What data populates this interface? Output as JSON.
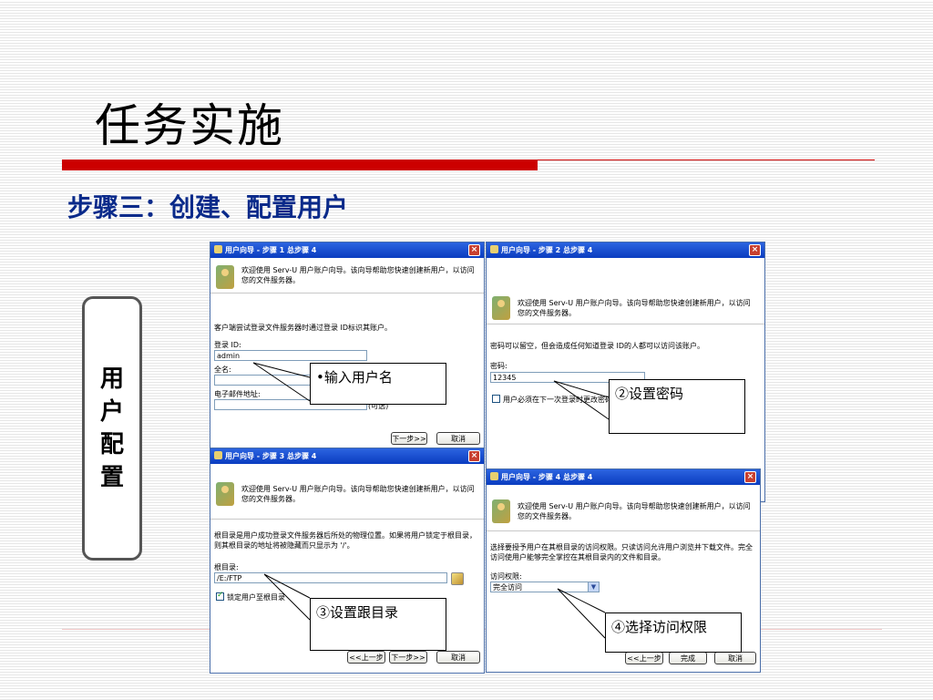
{
  "slide": {
    "title": "任务实施",
    "subtitle": "步骤三：创建、配置用户",
    "side_label": [
      "用",
      "户",
      "配",
      "置"
    ]
  },
  "dialogs": {
    "step1": {
      "title": "用户向导 - 步骤 1 总步骤 4",
      "header": "欢迎使用 Serv-U 用户账户向导。该向导帮助您快速创建新用户，以访问您的文件服务器。",
      "desc": "客户端尝试登录文件服务器时通过登录 ID标识其账户。",
      "login_label": "登录 ID:",
      "login_value": "admin",
      "fullname_label": "全名:",
      "email_label": "电子邮件地址:",
      "optional_hint": "(可选)",
      "next_button": "下一步>>",
      "cancel_button": "取消"
    },
    "step2": {
      "title": "用户向导 - 步骤 2 总步骤 4",
      "header": "欢迎使用 Serv-U 用户账户向导。该向导帮助您快速创建新用户，以访问您的文件服务器。",
      "desc": "密码可以留空，但会造成任何知道登录 ID的人都可以访问该账户。",
      "password_label": "密码:",
      "password_value": "12345",
      "checkbox_label": "用户必须在下一次登录时更改密码"
    },
    "step3": {
      "title": "用户向导 - 步骤 3 总步骤 4",
      "header": "欢迎使用 Serv-U 用户账户向导。该向导帮助您快速创建新用户，以访问您的文件服务器。",
      "desc": "根目录是用户成功登录文件服务器后所处的物理位置。如果将用户锁定于根目录，则其根目录的地址将被隐藏而只显示为 '/'。",
      "root_label": "根目录:",
      "root_value": "/E:/FTP",
      "lock_label": "锁定用户至根目录",
      "back_button": "<<上一步",
      "next_button": "下一步>>",
      "cancel_button": "取消"
    },
    "step4": {
      "title": "用户向导 - 步骤 4 总步骤 4",
      "header": "欢迎使用 Serv-U 用户账户向导。该向导帮助您快速创建新用户，以访问您的文件服务器。",
      "desc": "选择要授予用户在其根目录的访问权限。只读访问允许用户浏览并下载文件。完全访问使用户能够完全掌控在其根目录内的文件和目录。",
      "access_label": "访问权限:",
      "access_value": "完全访问",
      "back_button": "<<上一步",
      "finish_button": "完成",
      "cancel_button": "取消"
    }
  },
  "callouts": {
    "c1": "•输入用户名",
    "c2": "②设置密码",
    "c3": "③设置跟目录",
    "c4": "④选择访问权限"
  },
  "colors": {
    "accent_red": "#cc0000",
    "subtitle_blue": "#0a2a8a",
    "titlebar_blue": "#0a3cc0"
  }
}
